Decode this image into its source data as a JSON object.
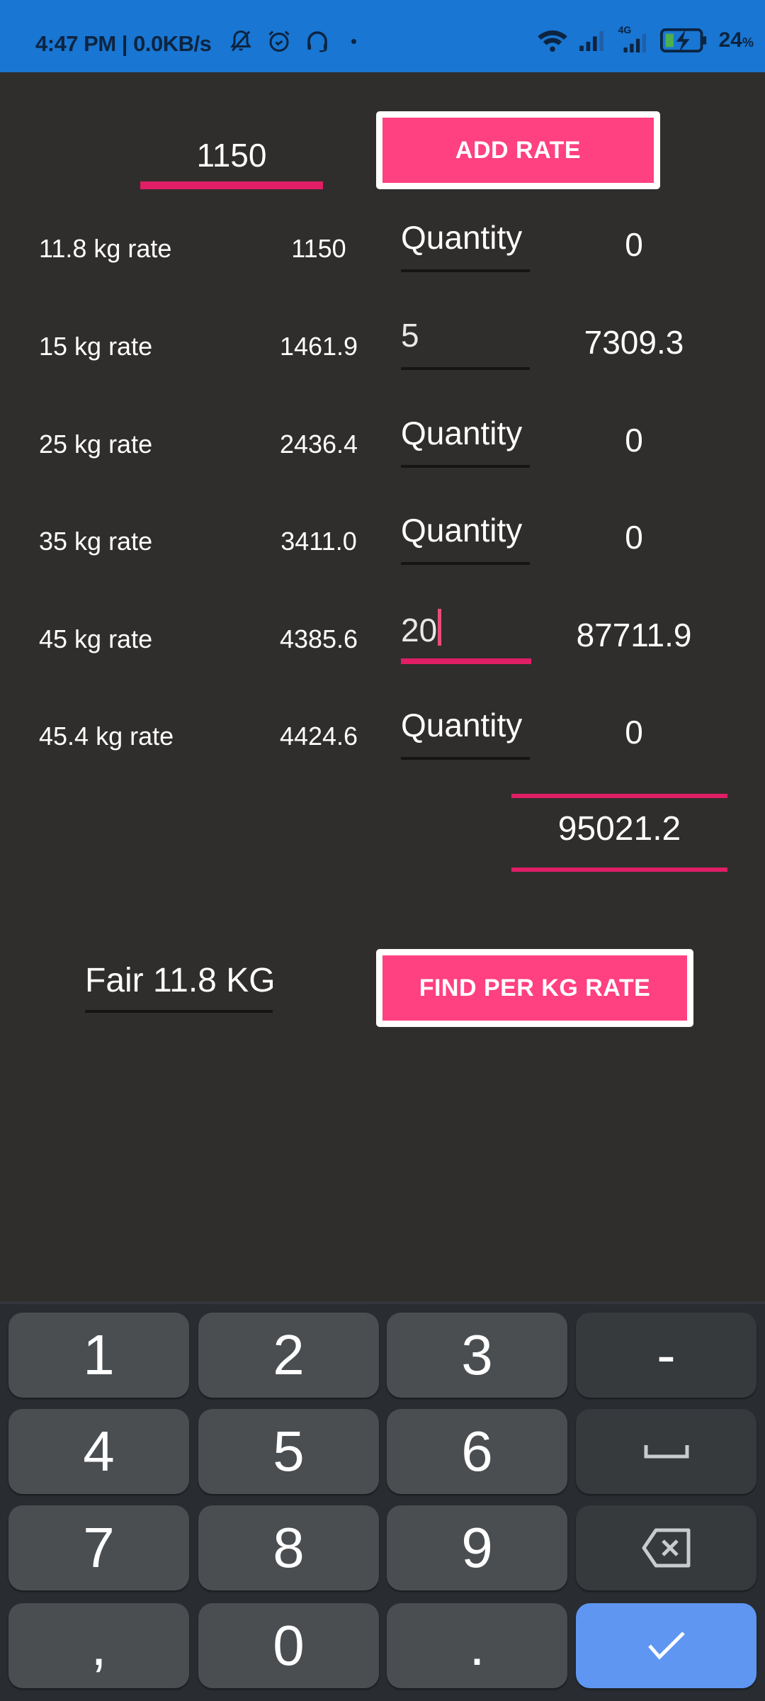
{
  "status_bar": {
    "time": "4:47 PM",
    "network_speed": "0.0KB/s",
    "separator": "|",
    "left_icons": [
      "bell-muted-icon",
      "alarm-icon",
      "headset-icon",
      "notification-dot-icon"
    ],
    "right_icons": [
      "wifi-icon",
      "signal-icon",
      "signal-4g-icon",
      "battery-charging-icon"
    ],
    "network_type": "4G",
    "battery_percent": "24",
    "battery_percent_sign": "%"
  },
  "rate_entry": {
    "value": "1150",
    "add_button_label": "ADD RATE"
  },
  "rows": [
    {
      "label": "11.8 kg rate",
      "rate": "1150",
      "quantity": "",
      "quantity_placeholder": "Quantity",
      "total": "0"
    },
    {
      "label": "15 kg rate",
      "rate": "1461.9",
      "quantity": "5",
      "quantity_placeholder": "Quantity",
      "total": "7309.3"
    },
    {
      "label": "25 kg rate",
      "rate": "2436.4",
      "quantity": "",
      "quantity_placeholder": "Quantity",
      "total": "0"
    },
    {
      "label": "35 kg rate",
      "rate": "3411.0",
      "quantity": "",
      "quantity_placeholder": "Quantity",
      "total": "0"
    },
    {
      "label": "45 kg rate",
      "rate": "4385.6",
      "quantity": "20",
      "quantity_placeholder": "Quantity",
      "total": "87711.9"
    },
    {
      "label": "45.4 kg rate",
      "rate": "4424.6",
      "quantity": "",
      "quantity_placeholder": "Quantity",
      "total": "0"
    }
  ],
  "grand_total": "95021.2",
  "fair": {
    "value": "Fair 11.8 KG",
    "button_label": "FIND PER KG RATE"
  },
  "keyboard": {
    "keys": [
      [
        "1",
        "2",
        "3",
        "-"
      ],
      [
        "4",
        "5",
        "6",
        "space"
      ],
      [
        "7",
        "8",
        "9",
        "backspace"
      ],
      [
        ",",
        "0",
        ".",
        "done"
      ]
    ]
  },
  "colors": {
    "status_bar": "#1976d2",
    "background": "#302e2d",
    "accent": "#ff4081",
    "underline_active": "#e01e66",
    "keyboard_bg": "#292c30",
    "key_bg": "#4a4e51",
    "enter_key": "#5e96f2"
  }
}
